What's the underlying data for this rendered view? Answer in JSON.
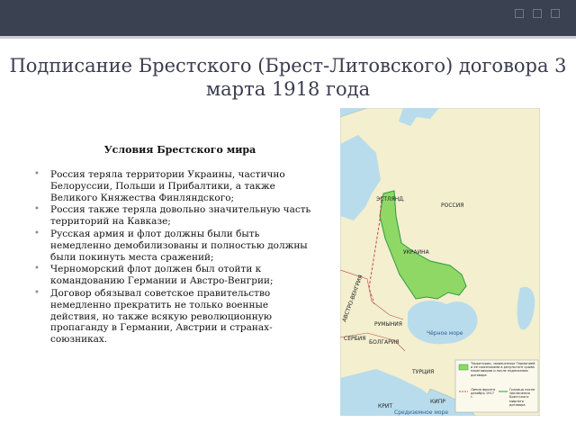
{
  "slide": {
    "title": "Подписание Брестского (Брест-Литовского) договора 3 марта 1918 года",
    "subtitle": "Условия Брестского мира",
    "bullets": [
      "Россия теряла территории Украины, частично Белоруссии, Польши и Прибалтики, а также Великого Княжества Финляндского;",
      "Россия также теряла довольно значительную часть территорий на Кавказе;",
      "Русская армия и флот должны были быть немедленно демобилизованы и полностью должны были покинуть места сражений;",
      "Черноморский флот должен был отойти к командованию Германии и Австро-Венгрии;",
      "Договор обязывал советское правительство немедленно прекратить не только военные действия, но также всякую революционную пропаганду в Германии, Австрии и странах-союзниках."
    ]
  },
  "map": {
    "labels": {
      "russia": "РОССИЯ",
      "austria_hungary": "АВСТРО-ВЕНГРИЯ",
      "romania": "РУМЫНИЯ",
      "serbia": "СЕРБИЯ",
      "bulgaria": "БОЛГАРИЯ",
      "black_sea": "Чёрное море",
      "turkey": "ТУРЦИЯ",
      "cyprus": "КИПР",
      "crete": "КРИТ",
      "mediterranean": "Средиземное море",
      "ukraine": "УКРАИНА",
      "estonia": "ЭСТЛЯНД."
    },
    "legend": {
      "item1": "Территории, захваченные Германией и ее союзниками в результате срыва переговоров и после подписания договора",
      "item2": "Линия фронта декабрь 1917 г.",
      "item3": "Граница после заключения Брестского мирного договора"
    },
    "colors": {
      "sea": "#b9dcec",
      "land": "#f3efcf",
      "occupied": "#8fd866",
      "occupied_border": "#2f9a3b",
      "border": "#c44b4b"
    }
  }
}
